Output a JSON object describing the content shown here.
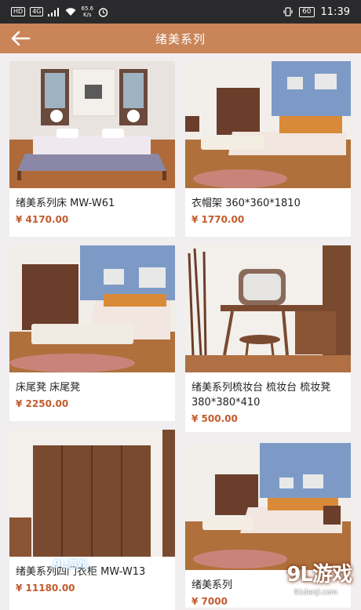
{
  "status_bar": {
    "left_badge": "HD",
    "net_badge": "4G",
    "speed_value": "65.6",
    "speed_unit": "K/s",
    "battery": "60",
    "time": "11:39"
  },
  "header": {
    "title": "绪美系列",
    "back_icon": "arrow-left-icon"
  },
  "products": [
    {
      "name": "绪美系列床 MW-W61",
      "price": "¥ 4170.00"
    },
    {
      "name": "衣帽架 360*360*1810",
      "price": "¥ 1770.00"
    },
    {
      "name": "床尾凳 床尾凳",
      "price": "¥ 2250.00"
    },
    {
      "name": "绪美系列梳妆台 梳妆台 梳妆凳380*380*410",
      "price": "¥ 500.00"
    },
    {
      "name": "绪美系列四门衣柜 MW-W13",
      "price": "¥ 11180.00"
    },
    {
      "name": "绪美系列",
      "price": "¥ 7000"
    }
  ],
  "watermark": {
    "logo": "9L游戏",
    "url": "91danji.com",
    "overlay": "9L游戏"
  },
  "colors": {
    "header_bg": "#c98457",
    "price": "#c45a2c"
  }
}
